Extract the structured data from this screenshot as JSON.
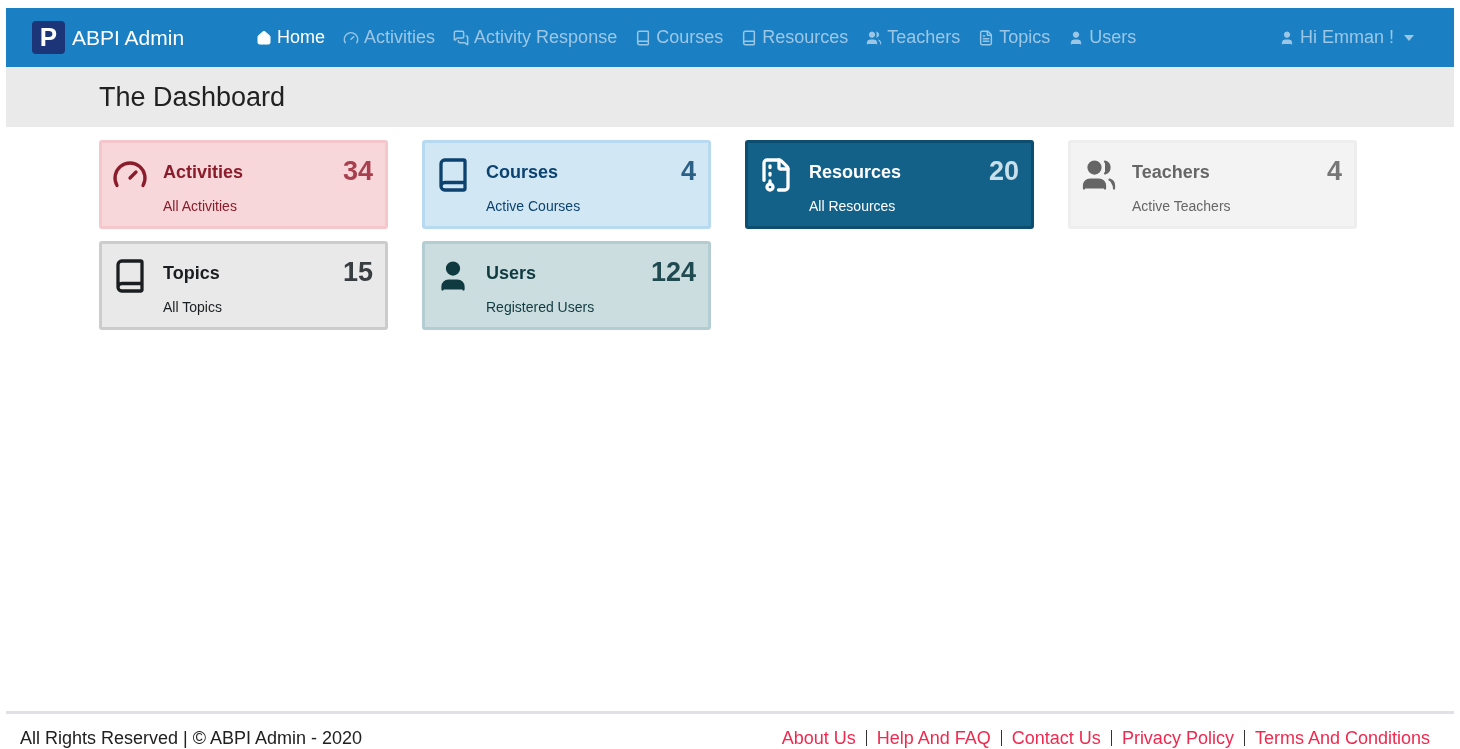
{
  "navbar": {
    "logo_letter": "P",
    "brand": "ABPI Admin",
    "items": [
      {
        "label": "Home",
        "selected": true
      },
      {
        "label": "Activities",
        "selected": false
      },
      {
        "label": "Activity Response",
        "selected": false
      },
      {
        "label": "Courses",
        "selected": false
      },
      {
        "label": "Resources",
        "selected": false
      },
      {
        "label": "Teachers",
        "selected": false
      },
      {
        "label": "Topics",
        "selected": false
      },
      {
        "label": "Users",
        "selected": false
      }
    ],
    "user_menu": {
      "label": "Hi Emman !"
    }
  },
  "page_title": "The Dashboard",
  "cards": [
    {
      "kind": "danger",
      "title": "Activities",
      "count": "34",
      "subtitle": "All Activities"
    },
    {
      "kind": "info",
      "title": "Courses",
      "count": "4",
      "subtitle": "Active Courses"
    },
    {
      "kind": "primary",
      "title": "Resources",
      "count": "20",
      "subtitle": "All Resources"
    },
    {
      "kind": "light",
      "title": "Teachers",
      "count": "4",
      "subtitle": "Active Teachers"
    },
    {
      "kind": "secondary",
      "title": "Topics",
      "count": "15",
      "subtitle": "All Topics"
    },
    {
      "kind": "teal",
      "title": "Users",
      "count": "124",
      "subtitle": "Registered Users"
    }
  ],
  "footer": {
    "copyright": "All Rights Reserved | © ABPI Admin - 2020",
    "links": [
      "About Us",
      "Help And FAQ",
      "Contact Us",
      "Privacy Policy",
      "Terms And Conditions"
    ]
  }
}
